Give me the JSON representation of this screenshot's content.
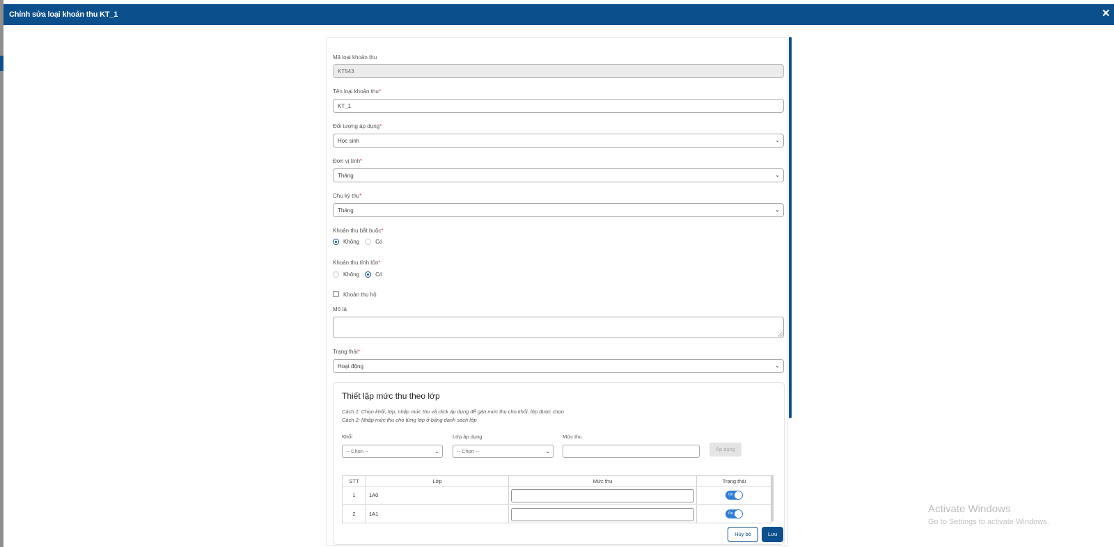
{
  "dialog": {
    "title": "Chỉnh sửa loại khoản thu KT_1",
    "close_icon": "×"
  },
  "form": {
    "ma_loai": {
      "label": "Mã loại khoản thu",
      "value": "KT543"
    },
    "ten_loai": {
      "label": "Tên loại khoản thu",
      "required": "*",
      "value": "KT_1"
    },
    "doi_tuong": {
      "label": "Đối tượng áp dụng",
      "required": "*",
      "value": "Học sinh"
    },
    "don_vi": {
      "label": "Đơn vị tính",
      "required": "*",
      "value": "Tháng"
    },
    "chu_ky": {
      "label": "Chu kỳ thu",
      "required": "*",
      "value": "Tháng"
    },
    "bat_buoc": {
      "label": "Khoản thu bắt buộc",
      "required": "*",
      "options": [
        "Không",
        "Có"
      ],
      "selected": "Không"
    },
    "tinh_ton": {
      "label": "Khoản thu tính tồn",
      "required": "*",
      "options": [
        "Không",
        "Có"
      ],
      "selected": "Có"
    },
    "thu_ho": {
      "label": "Khoản thu hộ",
      "checked": false
    },
    "mo_ta": {
      "label": "Mô tả",
      "value": ""
    },
    "trang_thai": {
      "label": "Trạng thái",
      "required": "*",
      "value": "Hoạt động"
    }
  },
  "section": {
    "title": "Thiết lập mức thu theo lớp",
    "hint1": "Cách 1: Chọn khối, lớp, nhập mức thu và click áp dụng để gán mức thu cho khối, lớp được chọn",
    "hint2": "Cách 2: Nhập mức thu cho từng lớp ở bảng danh sách lớp",
    "khoi": {
      "label": "Khối",
      "value": "-- Chọn --"
    },
    "lop_ap_dung": {
      "label": "Lớp áp dụng",
      "value": "-- Chọn --"
    },
    "muc_thu": {
      "label": "Mức thu",
      "value": ""
    },
    "apply_label": "Áp dụng",
    "table": {
      "headers": [
        "STT",
        "Lớp",
        "Mức thu",
        "Trạng thái"
      ],
      "rows": [
        {
          "stt": "1",
          "lop": "1A0",
          "muc_thu": "",
          "status": "On"
        },
        {
          "stt": "2",
          "lop": "1A1",
          "muc_thu": "",
          "status": "On"
        }
      ]
    }
  },
  "footer": {
    "cancel_label": "Hủy bỏ",
    "save_label": "Lưu"
  },
  "watermark": {
    "line1": "Activate Windows",
    "line2": "Go to Settings to activate Windows."
  },
  "colors": {
    "primary": "#0c4f8d",
    "toggle_on": "#2f7fd6",
    "required": "#e53935"
  }
}
